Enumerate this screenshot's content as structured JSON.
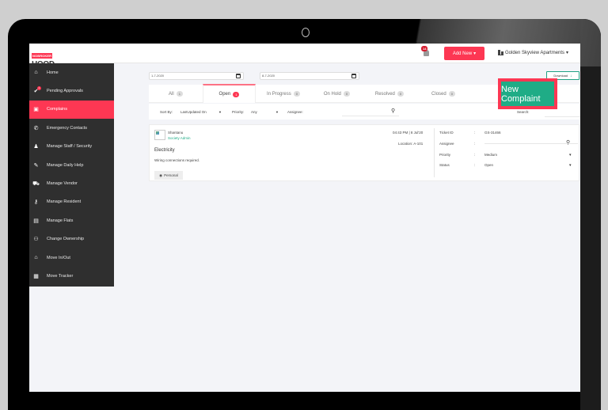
{
  "header": {
    "logo_top": "NOBROKER",
    "logo_bottom": "HOOD",
    "notification_count": "14",
    "add_new_label": "Add New",
    "society_name": "Golden Skyview Apartments"
  },
  "sidebar": {
    "items": [
      {
        "label": "Home",
        "icon": "home-icon",
        "glyph": "⌂"
      },
      {
        "label": "Pending Approvals",
        "icon": "check-badge-icon",
        "glyph": "✔",
        "badge": "1"
      },
      {
        "label": "Complains",
        "icon": "complaint-icon",
        "glyph": "▣",
        "active": true
      },
      {
        "label": "Emergency Contacts",
        "icon": "phone-icon",
        "glyph": "✆"
      },
      {
        "label": "Manage Staff / Security",
        "icon": "person-icon",
        "glyph": "♟"
      },
      {
        "label": "Manage Daily Help",
        "icon": "wrench-icon",
        "glyph": "✎"
      },
      {
        "label": "Manage Vendor",
        "icon": "truck-icon",
        "glyph": "⛟"
      },
      {
        "label": "Manage Resident",
        "icon": "key-icon",
        "glyph": "⚷"
      },
      {
        "label": "Manage Flats",
        "icon": "building-icon",
        "glyph": "▤"
      },
      {
        "label": "Change Ownership",
        "icon": "users-icon",
        "glyph": "⚇"
      },
      {
        "label": "Move In/Out",
        "icon": "house-move-icon",
        "glyph": "⌂"
      },
      {
        "label": "Move Tracker",
        "icon": "clipboard-icon",
        "glyph": "▦"
      }
    ]
  },
  "dates": {
    "from": "1-7-2020",
    "to": "8-7-2020"
  },
  "download_label": "Download",
  "tabs": [
    {
      "label": "All",
      "count": "1"
    },
    {
      "label": "Open",
      "count": "1",
      "active": true
    },
    {
      "label": "In Progress",
      "count": "0"
    },
    {
      "label": "On Hold",
      "count": "0"
    },
    {
      "label": "Resolved",
      "count": "0"
    },
    {
      "label": "Closed",
      "count": "0"
    }
  ],
  "new_complaint_label": "New Complaint",
  "filters": {
    "sort_by_label": "Sort By:",
    "sort_by_value": "LastUpdated On",
    "priority_label": "Priority:",
    "priority_value": "Any",
    "assignee_label": "Assignee:",
    "search_label": "Search:"
  },
  "complaint": {
    "user_name": "Shantanu",
    "user_role": "Society Admin",
    "category": "Electricity",
    "description": "Wiring connections required.",
    "visibility": "Personal",
    "timestamp": "04:43 PM | 8 Jul'20",
    "location": "Location: A-101",
    "ticket_id_label": "Ticket ID",
    "ticket_id": "GS-31466",
    "assignee_label": "Assignee",
    "assignee": "",
    "priority_label": "Priority",
    "priority": "Medium",
    "status_label": "Status",
    "status": "Open",
    "colon": ":"
  },
  "colors": {
    "accent": "#fd3753",
    "green": "#1fac86",
    "sidebar": "#2f2f2f"
  }
}
